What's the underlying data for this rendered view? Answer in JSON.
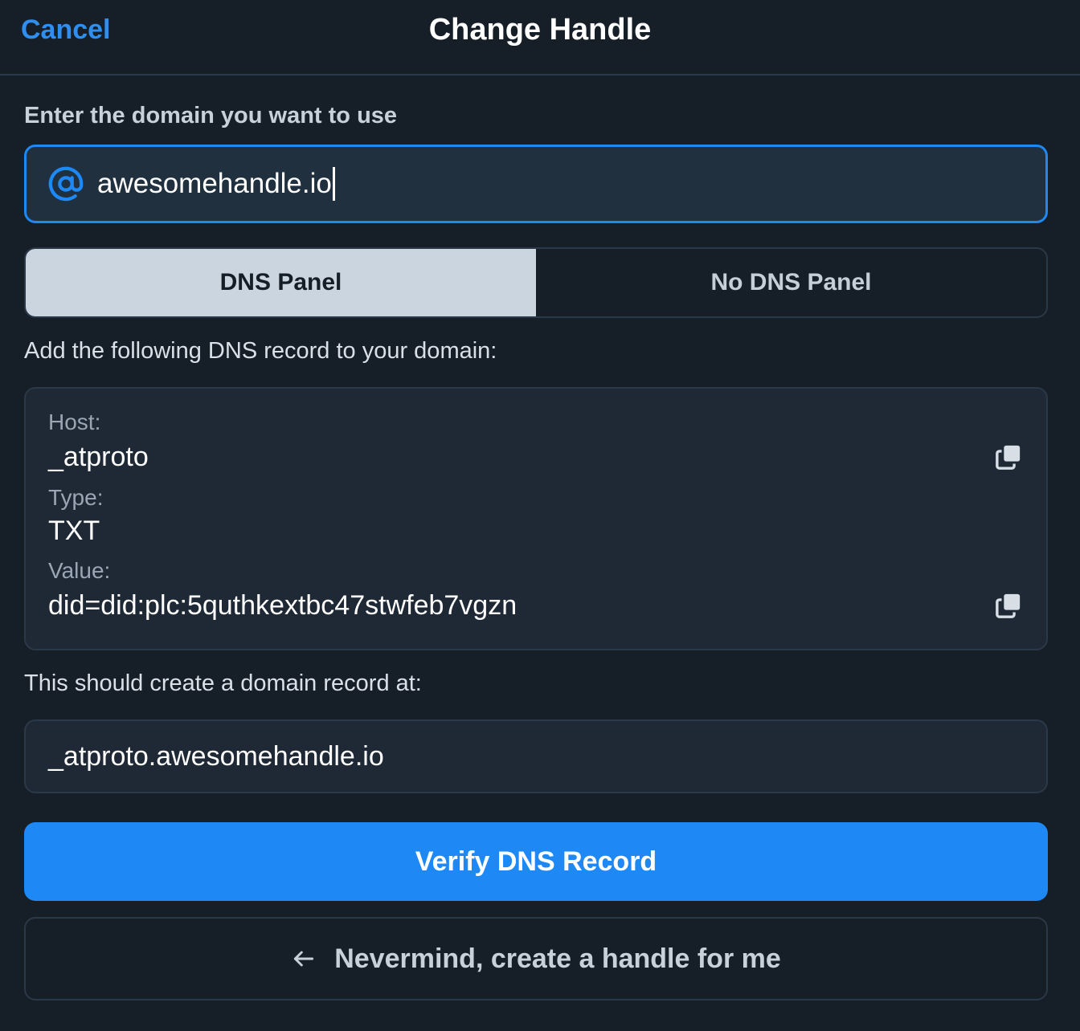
{
  "header": {
    "cancel_label": "Cancel",
    "title": "Change Handle"
  },
  "domain_prompt": "Enter the domain you want to use",
  "domain_input": {
    "icon": "at-icon",
    "value": "awesomehandle.io"
  },
  "tabs": [
    {
      "label": "DNS Panel",
      "selected": true
    },
    {
      "label": "No DNS Panel",
      "selected": false
    }
  ],
  "instructions": "Add the following DNS record to your domain:",
  "record": {
    "host_label": "Host:",
    "host_value": "_atproto",
    "type_label": "Type:",
    "type_value": "TXT",
    "value_label": "Value:",
    "value_value": "did=did:plc:5quthkextbc47stwfeb7vgzn",
    "copy_icon": "copy-icon"
  },
  "result_prompt": "This should create a domain record at:",
  "result_value": "_atproto.awesomehandle.io",
  "buttons": {
    "verify_label": "Verify DNS Record",
    "nevermind_label": "Nevermind, create a handle for me"
  },
  "colors": {
    "background": "#161e27",
    "accent": "#1e88f5",
    "panel": "#1e2935",
    "border": "#2a3848",
    "tab_active": "#cbd5df"
  }
}
